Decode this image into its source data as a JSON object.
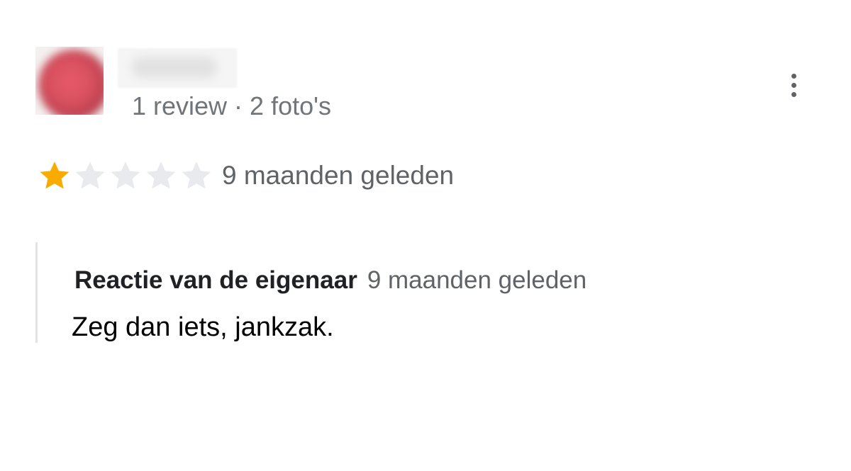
{
  "review": {
    "reviewer_meta": "1 review · 2 foto's",
    "rating": 1,
    "rating_max": 5,
    "star_filled_color": "#f9ab00",
    "star_empty_color": "#e8eaed",
    "time": "9 maanden geleden",
    "more_icon": "more-vert-icon"
  },
  "owner_response": {
    "label": "Reactie van de eigenaar",
    "time": "9 maanden geleden",
    "text": "Zeg dan iets, jankzak."
  }
}
